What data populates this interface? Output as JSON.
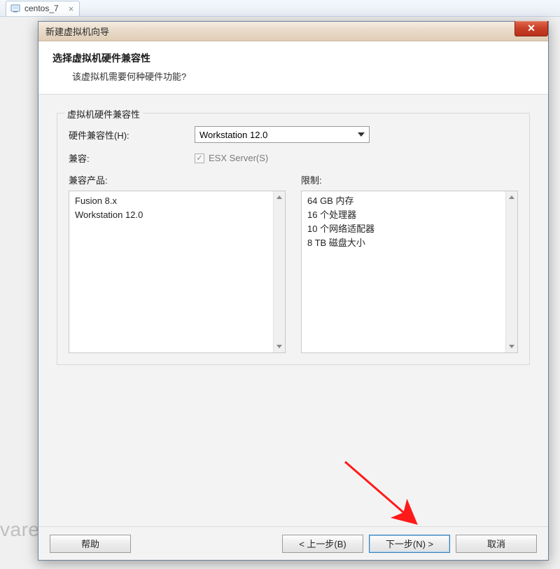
{
  "background": {
    "tab_label": "centos_7",
    "watermark_fragment": "vare"
  },
  "dialog": {
    "title": "新建虚拟机向导",
    "header_title": "选择虚拟机硬件兼容性",
    "header_subtitle": "该虚拟机需要何种硬件功能?",
    "group_legend": "虚拟机硬件兼容性",
    "hw_compat_label": "硬件兼容性(H):",
    "hw_compat_value": "Workstation 12.0",
    "compat_row_label": "兼容:",
    "checkbox_label": "ESX Server(S)",
    "checkbox_checked": true,
    "checkbox_disabled": true,
    "compatible_products_label": "兼容产品:",
    "compatible_products": [
      "Fusion 8.x",
      "Workstation 12.0"
    ],
    "limits_label": "限制:",
    "limits": [
      "64 GB 内存",
      "16 个处理器",
      "10 个网络适配器",
      "8 TB 磁盘大小"
    ],
    "buttons": {
      "help": "帮助",
      "back": "< 上一步(B)",
      "next": "下一步(N) >",
      "cancel": "取消"
    }
  }
}
